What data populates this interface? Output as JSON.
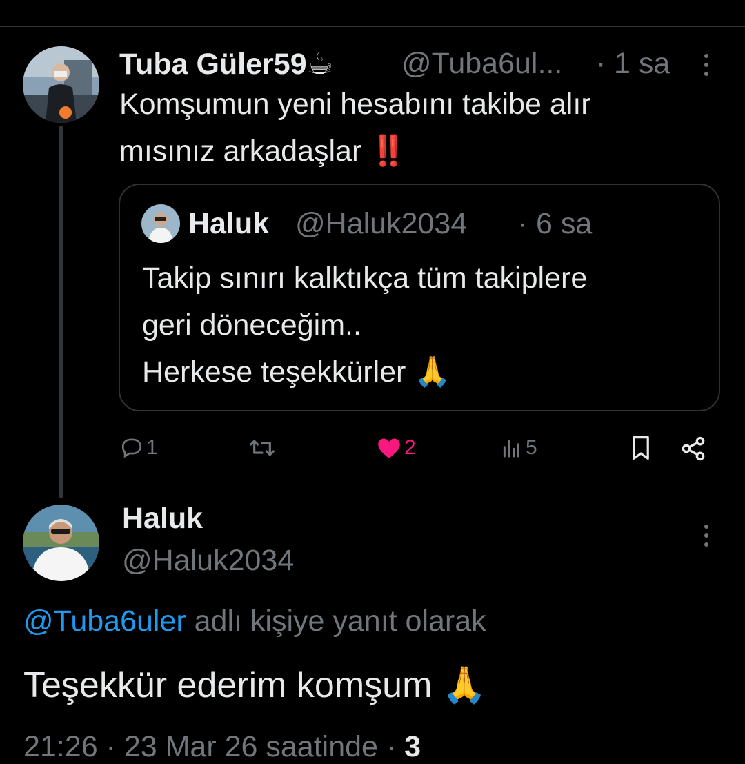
{
  "parent_tweet": {
    "display_name": "Tuba Güler59☕",
    "handle": "@Tuba6ul...",
    "separator": "·",
    "time": "1 sa",
    "text_line1": "Komşumun yeni hesabını takibe alır",
    "text_line2": "mısınız arkadaşlar ‼️",
    "quoted": {
      "display_name": "Haluk",
      "handle": "@Haluk2034",
      "separator": "·",
      "time": "6 sa",
      "line1": "Takip sınırı kalktıkça tüm takiplere",
      "line2": "geri döneceğim..",
      "line3": "Herkese teşekkürler 🙏"
    },
    "actions": {
      "reply_count": "1",
      "retweet_count": "",
      "like_count": "2",
      "view_count": "5"
    },
    "colors": {
      "like": "#f91880",
      "muted": "#71767b"
    }
  },
  "reply_tweet": {
    "display_name": "Haluk",
    "handle": "@Haluk2034",
    "reply_to_mention": "@Tuba6uler",
    "reply_to_suffix": "adlı kişiye yanıt olarak",
    "text": "Teşekkür ederim komşum 🙏",
    "meta": "21:26 · 23 Mar 26 saatinde · ",
    "meta_count": "3"
  },
  "icons": [
    "reply-icon",
    "retweet-icon",
    "heart-icon",
    "views-icon",
    "bookmark-icon",
    "share-icon",
    "more-icon"
  ],
  "colors": {
    "background": "#000000",
    "text": "#e7e9ea",
    "link": "#1d9bf0",
    "border": "#2f3336"
  }
}
